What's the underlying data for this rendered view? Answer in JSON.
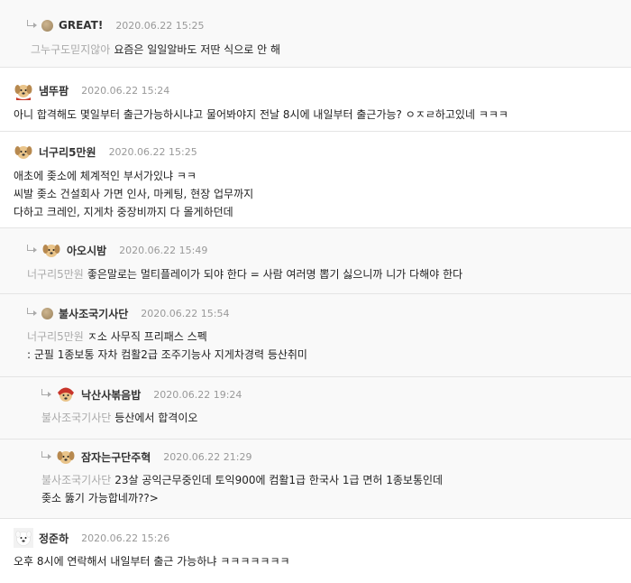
{
  "comments": [
    {
      "nick": "GREAT!",
      "date": "2020.06.22 15:25",
      "mention": "그누구도믿지않아",
      "lines": [
        "요즘은 일일알바도 저딴 식으로 안 해"
      ]
    },
    {
      "nick": "냄뚜팜",
      "date": "2020.06.22 15:24",
      "lines": [
        "아니 합격해도 몇일부터 출근가능하시냐고 물어봐야지 전날 8시에 내일부터 출근가능? ㅇㅈㄹ하고있네 ㅋㅋㅋ"
      ]
    },
    {
      "nick": "너구리5만원",
      "date": "2020.06.22 15:25",
      "lines": [
        "애초에 좆소에 체계적인 부서가있냐 ㅋㅋ",
        "씨발 좆소 건설회사 가면 인사, 마케팅, 현장 업무까지",
        "다하고 크레인, 지게차 중장비까지 다 몰게하던데"
      ]
    },
    {
      "nick": "아오시밤",
      "date": "2020.06.22 15:49",
      "mention": "너구리5만원",
      "lines": [
        "좋은말로는 멀티플레이가 되야 한다 = 사람 여러명 뽑기 싫으니까 니가 다해야 한다"
      ]
    },
    {
      "nick": "불사조국기사단",
      "date": "2020.06.22 15:54",
      "mention": "너구리5만원",
      "lines": [
        "ㅈ소 사무직 프리패스 스펙",
        ": 군필 1종보통 자차 컴활2급 조주기능사 지게차경력 등산취미"
      ]
    },
    {
      "nick": "낙산사볶음밥",
      "date": "2020.06.22 19:24",
      "mention": "불사조국기사단",
      "lines": [
        "등산에서 합격이오"
      ]
    },
    {
      "nick": "잠자는구단주혁",
      "date": "2020.06.22 21:29",
      "mention": "불사조국기사단",
      "lines": [
        "23살 공익근무중인데 토익900에 컴활1급 한국사 1급 면허 1종보통인데",
        "좆소 뚫기 가능합네까??>"
      ]
    },
    {
      "nick": "정준하",
      "date": "2020.06.22 15:26",
      "lines": [
        "오후 8시에 연락해서 내일부터 출근 가능하냐 ㅋㅋㅋㅋㅋㅋㅋ"
      ]
    }
  ]
}
